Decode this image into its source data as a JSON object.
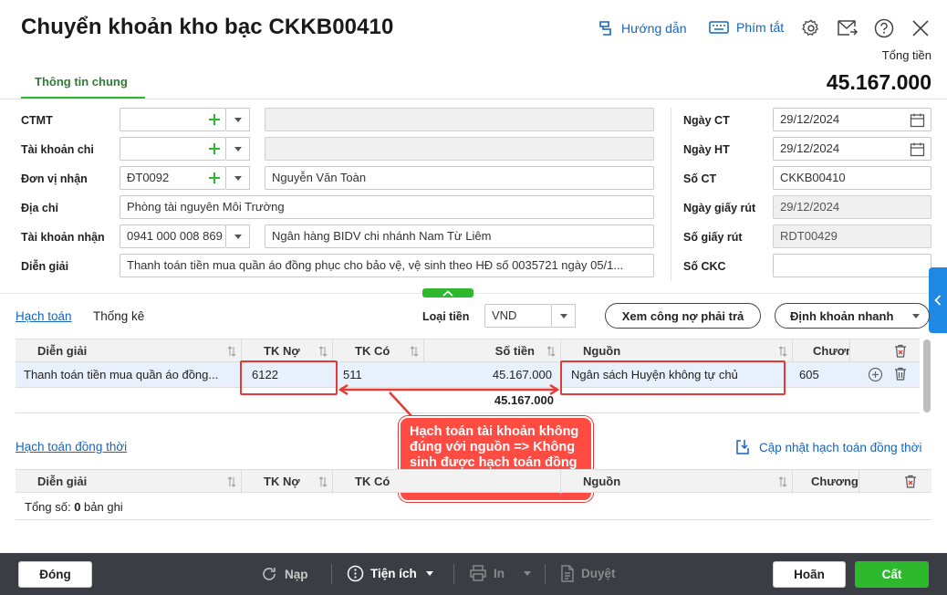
{
  "header": {
    "title": "Chuyển khoản kho bạc CKKB00410",
    "guide_label": "Hướng dẫn",
    "shortcut_label": "Phím tắt",
    "total_label": "Tổng tiền",
    "total_value": "45.167.000"
  },
  "tabs": [
    {
      "label": "Thông tin chung"
    }
  ],
  "form_left": {
    "ctmt_label": "CTMT",
    "ctmt_value": "",
    "tkchi_label": "Tài khoản chi",
    "tkchi_value": "",
    "donvi_label": "Đơn vị nhận",
    "donvi_code": "ĐT0092",
    "donvi_name": "Nguyễn Văn Toàn",
    "diachi_label": "Địa chỉ",
    "diachi_value": "Phòng tài nguyên Môi Trường",
    "tknhan_label": "Tài khoản nhận",
    "tknhan_value": "0941 000 008 869",
    "tknhan_bank": "Ngân hàng BIDV chi nhánh Nam Từ Liêm",
    "diengiai_label": "Diễn giải",
    "diengiai_value": "Thanh toán tiền mua quần áo đồng phục cho bảo vệ, vệ sinh theo HĐ số 0035721 ngày 05/1..."
  },
  "form_right": {
    "ngayct_label": "Ngày CT",
    "ngayct_value": "29/12/2024",
    "ngayht_label": "Ngày HT",
    "ngayht_value": "29/12/2024",
    "soct_label": "Số CT",
    "soct_value": "CKKB00410",
    "ngaygr_label": "Ngày giấy rút",
    "ngaygr_value": "29/12/2024",
    "sogr_label": "Số giấy rút",
    "sogr_value": "RDT00429",
    "sockc_label": "Số CKC",
    "sockc_value": ""
  },
  "detail_tabs": {
    "hachtoan": "Hạch toán",
    "thongke": "Thống kê",
    "loaitien_label": "Loại tiền",
    "loaitien_value": "VND",
    "xemcongno": "Xem công nợ phải trả",
    "dinhkhoan": "Định khoản nhanh"
  },
  "grid1": {
    "columns": [
      "Diễn giải",
      "TK Nợ",
      "TK Có",
      "Số tiền",
      "Nguồn",
      "Chươn"
    ],
    "rows": [
      {
        "diengiai": "Thanh toán tiền mua quần áo đồng...",
        "tkno": "6122",
        "tkco": "511",
        "sotien": "45.167.000",
        "nguon": "Ngân sách Huyện không tự chủ",
        "chuong": "605"
      }
    ],
    "total": "45.167.000"
  },
  "annotation": {
    "text": "Hạch toán tài khoản không đúng với nguồn => Không sinh được hạch toán đồng thời"
  },
  "grid2": {
    "title": "Hạch toán đồng thời",
    "update_label": "Cập nhật hạch toán đồng thời",
    "columns": [
      "Diễn giải",
      "TK Nợ",
      "TK Có",
      "Nguồn",
      "Chương"
    ],
    "summary_prefix": "Tổng số: ",
    "summary_count": "0",
    "summary_suffix": " bản ghi"
  },
  "footer": {
    "close": "Đóng",
    "load": "Nạp",
    "utility": "Tiện ích",
    "print": "In",
    "approve": "Duyệt",
    "undo": "Hoãn",
    "save": "Cất"
  },
  "colors": {
    "accent_green": "#2eb82e",
    "link_blue": "#1565c0",
    "alert_red": "#e53935",
    "footer_bg": "#3a3d44"
  }
}
